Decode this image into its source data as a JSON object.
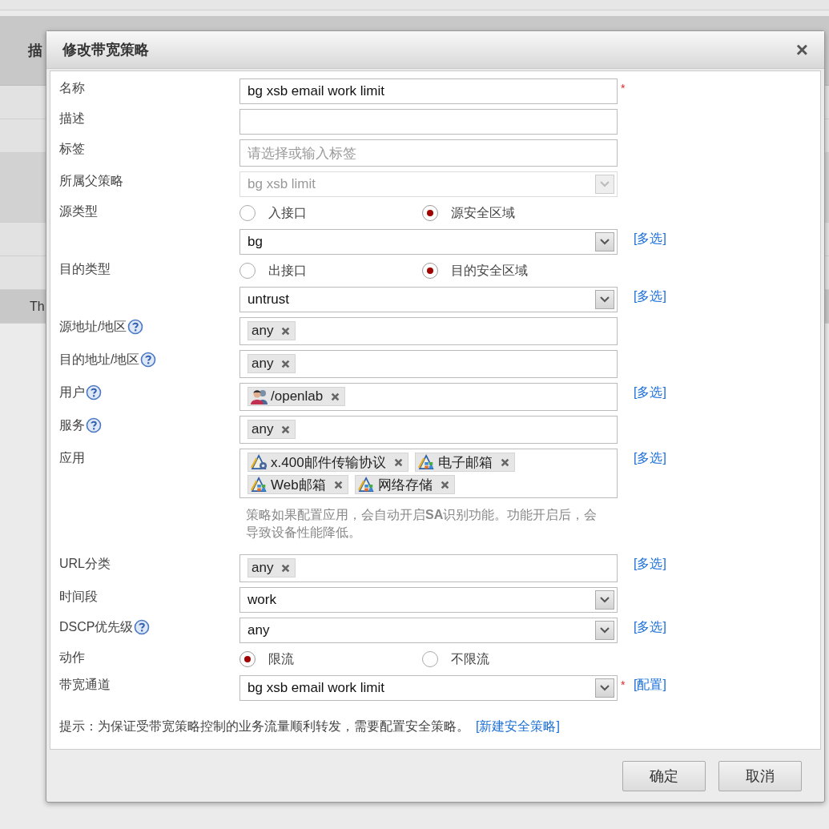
{
  "background": {
    "header_text": "描",
    "row_text": "Th"
  },
  "dialog": {
    "title": "修改带宽策略",
    "close": "×",
    "rows": [
      {
        "kind": "text",
        "label": "名称",
        "value": "bg xsb email work limit",
        "required": "*"
      },
      {
        "kind": "text",
        "label": "描述"
      },
      {
        "kind": "text",
        "label": "标签",
        "placeholder": "请选择或输入标签"
      },
      {
        "kind": "select",
        "label": "所属父策略",
        "value": "bg xsb limit",
        "disabled": true
      },
      {
        "kind": "radio",
        "label": "源类型",
        "options": [
          {
            "label": "入接口",
            "selected": false
          },
          {
            "label": "源安全区域",
            "selected": true
          }
        ]
      },
      {
        "kind": "select",
        "value": "bg",
        "disabled": false,
        "link": "[多选]"
      },
      {
        "kind": "radio",
        "label": "目的类型",
        "options": [
          {
            "label": "出接口",
            "selected": false
          },
          {
            "label": "目的安全区域",
            "selected": true
          }
        ]
      },
      {
        "kind": "select",
        "value": "untrust",
        "disabled": false,
        "link": "[多选]"
      },
      {
        "kind": "tags",
        "label": "源地址/地区",
        "help": true,
        "tags": [
          {
            "kind": "value",
            "text": "any"
          }
        ]
      },
      {
        "kind": "tags",
        "label": "目的地址/地区",
        "help": true,
        "tags": [
          {
            "kind": "value",
            "text": "any"
          }
        ]
      },
      {
        "kind": "tags",
        "label": "用户",
        "help": true,
        "tags": [
          {
            "kind": "user",
            "text": "/openlab"
          }
        ],
        "link": "[多选]"
      },
      {
        "kind": "tags",
        "label": "服务",
        "help": true,
        "tags": [
          {
            "kind": "value",
            "text": "any"
          }
        ]
      },
      {
        "kind": "tags",
        "label": "应用",
        "tags": [
          {
            "kind": "protocol",
            "text": "x.400邮件传输协议"
          },
          {
            "kind": "application",
            "text": "电子邮箱"
          },
          {
            "kind": "application",
            "text": "Web邮箱"
          },
          {
            "kind": "application",
            "text": "网络存储"
          }
        ],
        "link": "[多选]"
      },
      {
        "kind": "note",
        "text": "策略如果配置应用，会自动开启**SA**识别功能。功能开启后，会导致设备性能降低。"
      },
      {
        "kind": "tags",
        "label": "URL分类",
        "tags": [
          {
            "kind": "value",
            "text": "any"
          }
        ],
        "link": "[多选]"
      },
      {
        "kind": "select",
        "label": "时间段",
        "value": "work",
        "disabled": false
      },
      {
        "kind": "select",
        "label": "DSCP优先级",
        "help": true,
        "value": "any",
        "disabled": false,
        "link": "[多选]"
      },
      {
        "kind": "radio",
        "label": "动作",
        "options": [
          {
            "label": "限流",
            "selected": true
          },
          {
            "label": "不限流",
            "selected": false
          }
        ]
      },
      {
        "kind": "select",
        "label": "带宽通道",
        "value": "bg xsb email work limit",
        "disabled": false,
        "required": "*",
        "link": "[配置]"
      },
      {
        "kind": "hint",
        "text": "提示：为保证受带宽策略控制的业务流量顺利转发，需要配置安全策略。",
        "link": "[新建安全策略]"
      }
    ],
    "buttons": [
      "确定",
      "取消"
    ]
  }
}
